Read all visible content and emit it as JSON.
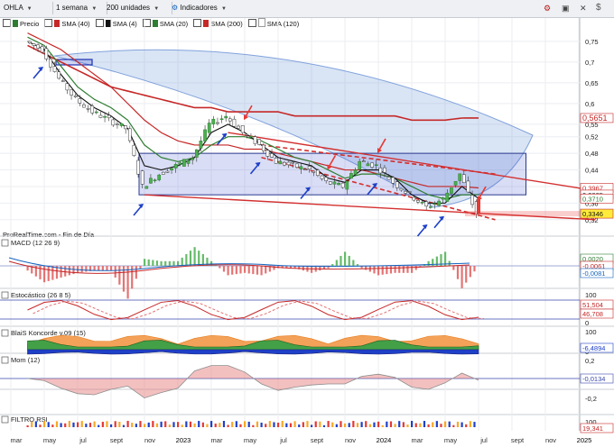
{
  "toolbar": {
    "instrument": "OHLA",
    "timeframe": "1 semana",
    "units": "200 unidades",
    "indicators_button": "Indicadores",
    "legend": [
      "Precio",
      "SMA (40)",
      "SMA (4)",
      "SMA (20)",
      "SMA (200)",
      "SMA (120)"
    ],
    "legend_colors": [
      "#2e7d32",
      "#c62828",
      "#111111",
      "#2e7d32",
      "#c62828",
      "#ffffff"
    ],
    "icons": [
      "settings-icon",
      "camera-icon",
      "close-icon",
      "money-icon"
    ]
  },
  "source_note": "ProRealTime.com - Fin de Día",
  "x_axis_labels": [
    "mar",
    "may",
    "jul",
    "sept",
    "nov",
    "2023",
    "mar",
    "may",
    "jul",
    "sept",
    "nov",
    "2024",
    "mar",
    "may",
    "jul",
    "sept",
    "nov",
    "2025"
  ],
  "panels": [
    {
      "name": "Precio",
      "ticks": [
        "0,75",
        "0,7",
        "0,65",
        "0,6",
        "0,55",
        "0,52",
        "0,48",
        "0,44",
        "0,4",
        "0,36",
        "0,32"
      ],
      "badges": [
        "0,5651",
        "0,3967",
        "0,3805",
        "0,3710",
        "0,3346"
      ]
    },
    {
      "name": "MACD (12 26 9)",
      "ticks": [],
      "badges": [
        "0,0020",
        "-0,0061",
        "-0,0081"
      ]
    },
    {
      "name": "Estocástico (26 8 5)",
      "ticks": [
        "100",
        "0"
      ],
      "badges": [
        "51,504",
        "46,708"
      ]
    },
    {
      "name": "BlaiS Koncorde v.09 (15)",
      "ticks": [
        "100",
        "0"
      ],
      "badges": [
        "-6,4894"
      ]
    },
    {
      "name": "Mom (12)",
      "ticks": [
        "0,2",
        "0",
        "-0,2"
      ],
      "badges": [
        "-0,0134"
      ]
    },
    {
      "name": "FILTRO RSI",
      "ticks": [
        "100",
        "0"
      ],
      "badges": [
        "19,341"
      ]
    }
  ],
  "chart_data": {
    "type": "line",
    "title": "OHLA",
    "x": [
      "2022-03",
      "2022-04",
      "2022-05",
      "2022-06",
      "2022-07",
      "2022-08",
      "2022-09",
      "2022-10",
      "2022-11",
      "2022-12",
      "2023-01",
      "2023-02",
      "2023-03",
      "2023-04",
      "2023-05",
      "2023-06",
      "2023-07",
      "2023-08",
      "2023-09",
      "2023-10",
      "2023-11",
      "2023-12",
      "2024-01",
      "2024-02",
      "2024-03",
      "2024-04",
      "2024-05",
      "2024-06"
    ],
    "series": [
      {
        "name": "Precio",
        "values": [
          0.75,
          0.73,
          0.66,
          0.61,
          0.58,
          0.56,
          0.54,
          0.4,
          0.43,
          0.45,
          0.47,
          0.55,
          0.57,
          0.53,
          0.5,
          0.46,
          0.45,
          0.44,
          0.41,
          0.4,
          0.46,
          0.45,
          0.41,
          0.38,
          0.35,
          0.37,
          0.43,
          0.3346
        ]
      },
      {
        "name": "SMA (200)",
        "values": [
          0.74,
          0.72,
          0.7,
          0.68,
          0.66,
          0.64,
          0.63,
          0.62,
          0.61,
          0.6,
          0.59,
          0.59,
          0.58,
          0.58,
          0.58,
          0.58,
          0.57,
          0.57,
          0.57,
          0.57,
          0.57,
          0.57,
          0.57,
          0.56,
          0.56,
          0.56,
          0.565,
          0.5651
        ]
      },
      {
        "name": "SMA (120)",
        "values": [
          0.77,
          0.75,
          0.73,
          0.7,
          0.67,
          0.64,
          0.6,
          0.56,
          0.53,
          0.51,
          0.5,
          0.5,
          0.5,
          0.49,
          0.49,
          0.48,
          0.47,
          0.46,
          0.45,
          0.44,
          0.44,
          0.43,
          0.42,
          0.41,
          0.4,
          0.4,
          0.4,
          0.3967
        ]
      },
      {
        "name": "SMA (40)",
        "values": [
          0.76,
          0.74,
          0.69,
          0.64,
          0.61,
          0.59,
          0.56,
          0.5,
          0.47,
          0.46,
          0.47,
          0.5,
          0.52,
          0.52,
          0.51,
          0.49,
          0.47,
          0.46,
          0.44,
          0.42,
          0.43,
          0.43,
          0.42,
          0.4,
          0.38,
          0.37,
          0.38,
          0.3805
        ]
      },
      {
        "name": "SMA (20)",
        "values": [
          0.75,
          0.73,
          0.67,
          0.62,
          0.59,
          0.57,
          0.54,
          0.45,
          0.44,
          0.45,
          0.47,
          0.53,
          0.55,
          0.53,
          0.5,
          0.47,
          0.46,
          0.45,
          0.42,
          0.41,
          0.44,
          0.44,
          0.42,
          0.38,
          0.36,
          0.36,
          0.4,
          0.371
        ]
      }
    ],
    "ylim": [
      0.3,
      0.78
    ],
    "ylabel": "",
    "xlabel": "",
    "grid": true,
    "legend_position": "top",
    "price_zone": {
      "low": 0.38,
      "high": 0.48,
      "from": "2022-10",
      "to": "2024-07"
    },
    "resistance_line": {
      "from": [
        "2023-03",
        0.53
      ],
      "to": [
        "2025-01",
        0.39
      ]
    },
    "support_line": {
      "from": [
        "2022-10",
        0.38
      ],
      "to": [
        "2025-01",
        0.32
      ]
    },
    "dashed_channel": [
      {
        "from": [
          "2023-05",
          0.5
        ],
        "to": [
          "2024-07",
          0.43
        ]
      },
      {
        "from": [
          "2023-05",
          0.47
        ],
        "to": [
          "2024-07",
          0.32
        ]
      }
    ],
    "buy_arrows": [
      "2022-04",
      "2022-10",
      "2023-03",
      "2023-05",
      "2023-08",
      "2023-12",
      "2024-03",
      "2024-04"
    ],
    "sell_arrows": [
      "2023-04",
      "2023-09",
      "2023-12",
      "2024-06"
    ],
    "indicator_types": [
      "macd-histogram",
      "stochastic",
      "koncorde",
      "momentum",
      "rsi-filter"
    ]
  }
}
